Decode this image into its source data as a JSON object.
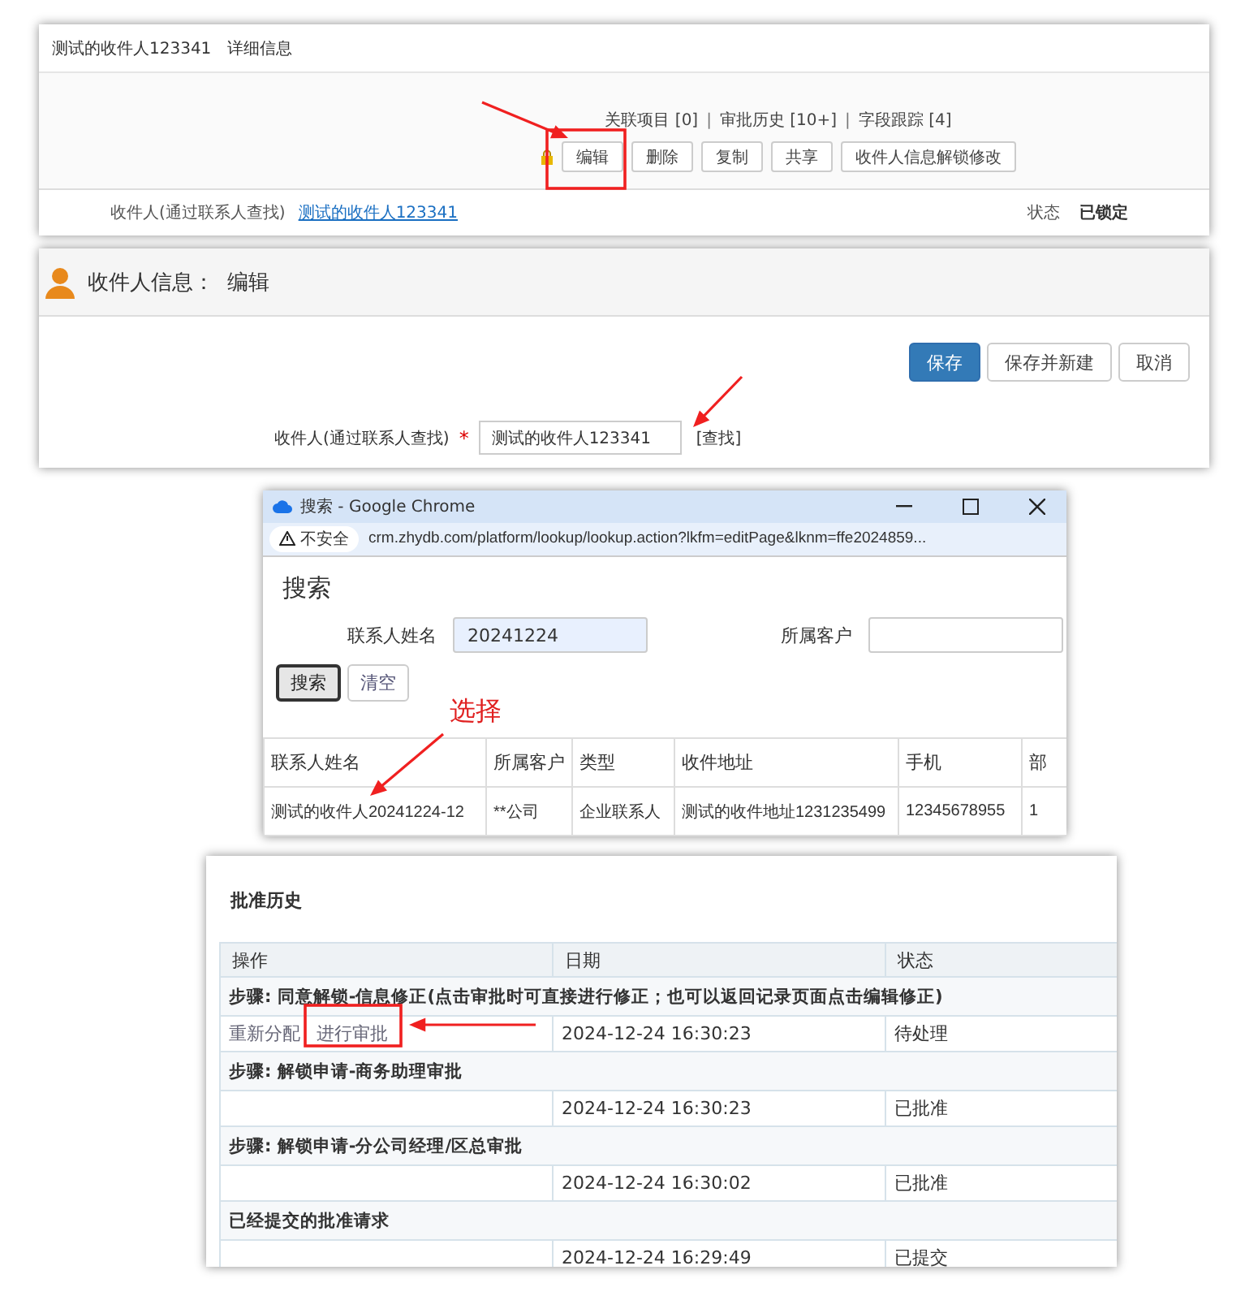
{
  "detail_panel": {
    "title": "测试的收件人123341",
    "subtitle": "详细信息",
    "related_links": [
      "关联项目 [0]",
      "审批历史 [10+]",
      "字段跟踪 [4]"
    ],
    "separator": "|",
    "buttons": [
      {
        "label": "编辑",
        "locked": true
      },
      {
        "label": "删除",
        "locked": false
      },
      {
        "label": "复制",
        "locked": false
      },
      {
        "label": "共享",
        "locked": false
      },
      {
        "label": "收件人信息解锁修改",
        "locked": false
      }
    ],
    "field": {
      "label": "收件人(通过联系人查找)",
      "value": "测试的收件人123341"
    },
    "status": {
      "label": "状态",
      "value": "已锁定"
    }
  },
  "edit_panel": {
    "title": "收件人信息：",
    "mode": "编辑",
    "buttons": [
      {
        "label": "保存",
        "primary": true
      },
      {
        "label": "保存并新建",
        "primary": false
      },
      {
        "label": "取消",
        "primary": false
      }
    ],
    "field": {
      "label": "收件人(通过联系人查找)",
      "required": true,
      "required_mark": "*",
      "value": "测试的收件人123341",
      "lookup_link": "[查找]"
    }
  },
  "search_window": {
    "title": "搜索 - Google Chrome",
    "security_label": "不安全",
    "url": "crm.zhydb.com/platform/lookup/lookup.action?lkfm=editPage&lknm=ffe2024859...",
    "heading": "搜索",
    "fields": [
      {
        "label": "联系人姓名",
        "value": "20241224"
      },
      {
        "label": "所属客户"
      }
    ],
    "buttons": [
      {
        "label": "搜索",
        "selected": true
      },
      {
        "label": "清空",
        "selected": false
      }
    ],
    "columns": [
      "联系人姓名",
      "所属客户",
      "类型",
      "收件地址",
      "手机",
      "部"
    ],
    "rows": [
      [
        "测试的收件人20241224-12",
        "**公司",
        "企业联系人",
        "测试的收件地址1231235499",
        "12345678955",
        "1"
      ]
    ]
  },
  "history": {
    "title": "批准历史",
    "columns": [
      "操作",
      "日期",
      "状态"
    ],
    "groups": [
      {
        "step": "步骤: 同意解锁-信息修正(点击审批时可直接进行修正；也可以返回记录页面点击编辑修正)",
        "rows": [
          {
            "actions": [
              "重新分配",
              "进行审批"
            ],
            "date": "2024-12-24 16:30:23",
            "status": "待处理"
          }
        ]
      },
      {
        "step": "步骤: 解锁申请-商务助理审批",
        "rows": [
          {
            "actions": [],
            "date": "2024-12-24 16:30:23",
            "status": "已批准"
          }
        ]
      },
      {
        "step": "步骤: 解锁申请-分公司经理/区总审批",
        "rows": [
          {
            "actions": [],
            "date": "2024-12-24 16:30:02",
            "status": "已批准"
          }
        ]
      },
      {
        "step": "已经提交的批准请求",
        "rows": [
          {
            "actions": [],
            "date": "2024-12-24 16:29:49",
            "status": "已提交"
          }
        ]
      }
    ]
  },
  "annotations": {
    "select_label": "选择"
  }
}
